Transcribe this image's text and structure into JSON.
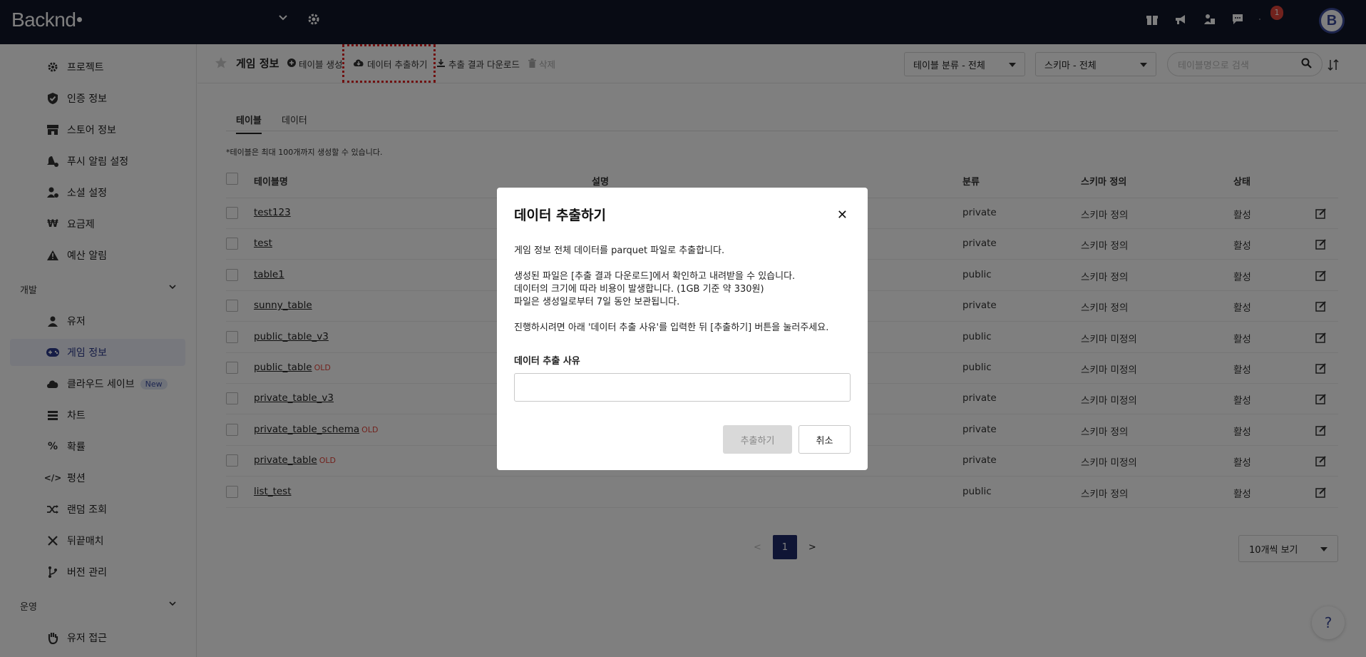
{
  "app": {
    "logo": "Backnd"
  },
  "topbar": {
    "notification_count": "1",
    "avatar_letter": "B"
  },
  "sidebar": {
    "items": [
      {
        "label": "프로젝트"
      },
      {
        "label": "인증 정보"
      },
      {
        "label": "스토어 정보"
      },
      {
        "label": "푸시 알림 설정"
      },
      {
        "label": "소셜 설정"
      },
      {
        "label": "요금제"
      },
      {
        "label": "예산 알림"
      }
    ],
    "section_dev": "개발",
    "dev_items": [
      {
        "label": "유저"
      },
      {
        "label": "게임 정보"
      },
      {
        "label": "클라우드 세이브",
        "badge": "New"
      },
      {
        "label": "차트"
      },
      {
        "label": "확률"
      },
      {
        "label": "펑션"
      },
      {
        "label": "랜덤 조회"
      },
      {
        "label": "뒤끝매치"
      },
      {
        "label": "버전 관리"
      }
    ],
    "section_ops": "운영",
    "ops_items": [
      {
        "label": "유저 접근"
      }
    ]
  },
  "toolbar": {
    "title": "게임 정보",
    "create_table": "테이블 생성",
    "extract_data": "데이터 추출하기",
    "download_result": "추출 결과 다운로드",
    "delete": "삭제",
    "category_select": "테이블 분류 - 전체",
    "schema_select": "스키마 - 전체",
    "search_placeholder": "테이블명으로 검색"
  },
  "tabs": [
    {
      "label": "테이블"
    },
    {
      "label": "데이터"
    }
  ],
  "note": "*테이블은 최대 100개까지 생성할 수 있습니다.",
  "table": {
    "headers": {
      "name": "테이블명",
      "desc": "설명",
      "category": "분류",
      "schema": "스키마 정의",
      "status": "상태"
    },
    "rows": [
      {
        "name": "test123",
        "old": "",
        "category": "private",
        "schema": "스키마 정의",
        "status": "활성"
      },
      {
        "name": "test",
        "old": "",
        "category": "private",
        "schema": "스키마 정의",
        "status": "활성"
      },
      {
        "name": "table1",
        "old": "",
        "category": "public",
        "schema": "스키마 정의",
        "status": "활성"
      },
      {
        "name": "sunny_table",
        "old": "",
        "category": "private",
        "schema": "스키마 정의",
        "status": "활성"
      },
      {
        "name": "public_table_v3",
        "old": "",
        "category": "public",
        "schema": "스키마 미정의",
        "status": "활성"
      },
      {
        "name": "public_table",
        "old": "OLD",
        "category": "public",
        "schema": "스키마 미정의",
        "status": "활성"
      },
      {
        "name": "private_table_v3",
        "old": "",
        "category": "private",
        "schema": "스키마 미정의",
        "status": "활성"
      },
      {
        "name": "private_table_schema",
        "old": "OLD",
        "category": "private",
        "schema": "스키마 정의",
        "status": "활성"
      },
      {
        "name": "private_table",
        "old": "OLD",
        "category": "private",
        "schema": "스키마 미정의",
        "status": "활성"
      },
      {
        "name": "list_test",
        "old": "",
        "category": "public",
        "schema": "스키마 정의",
        "status": "활성"
      }
    ]
  },
  "pagination": {
    "prev": "<",
    "current": "1",
    "next": ">",
    "per_page": "10개씩 보기"
  },
  "help": "?",
  "modal": {
    "title": "데이터 추출하기",
    "close": "✕",
    "line1": "게임 정보 전체 데이터를 parquet 파일로 추출합니다.",
    "line2": "생성된 파일은 [추출 결과 다운로드]에서 확인하고 내려받을 수 있습니다.",
    "line3": "데이터의 크기에 따라 비용이 발생합니다. (1GB 기준 약 330원)",
    "line4": "파일은 생성일로부터 7일 동안 보관됩니다.",
    "line5": "진행하시려면 아래 '데이터 추출 사유'를 입력한 뒤 [추출하기] 버튼을 눌러주세요.",
    "reason_label": "데이터 추출 사유",
    "reason_value": "",
    "extract_button": "추출하기",
    "cancel_button": "취소"
  }
}
